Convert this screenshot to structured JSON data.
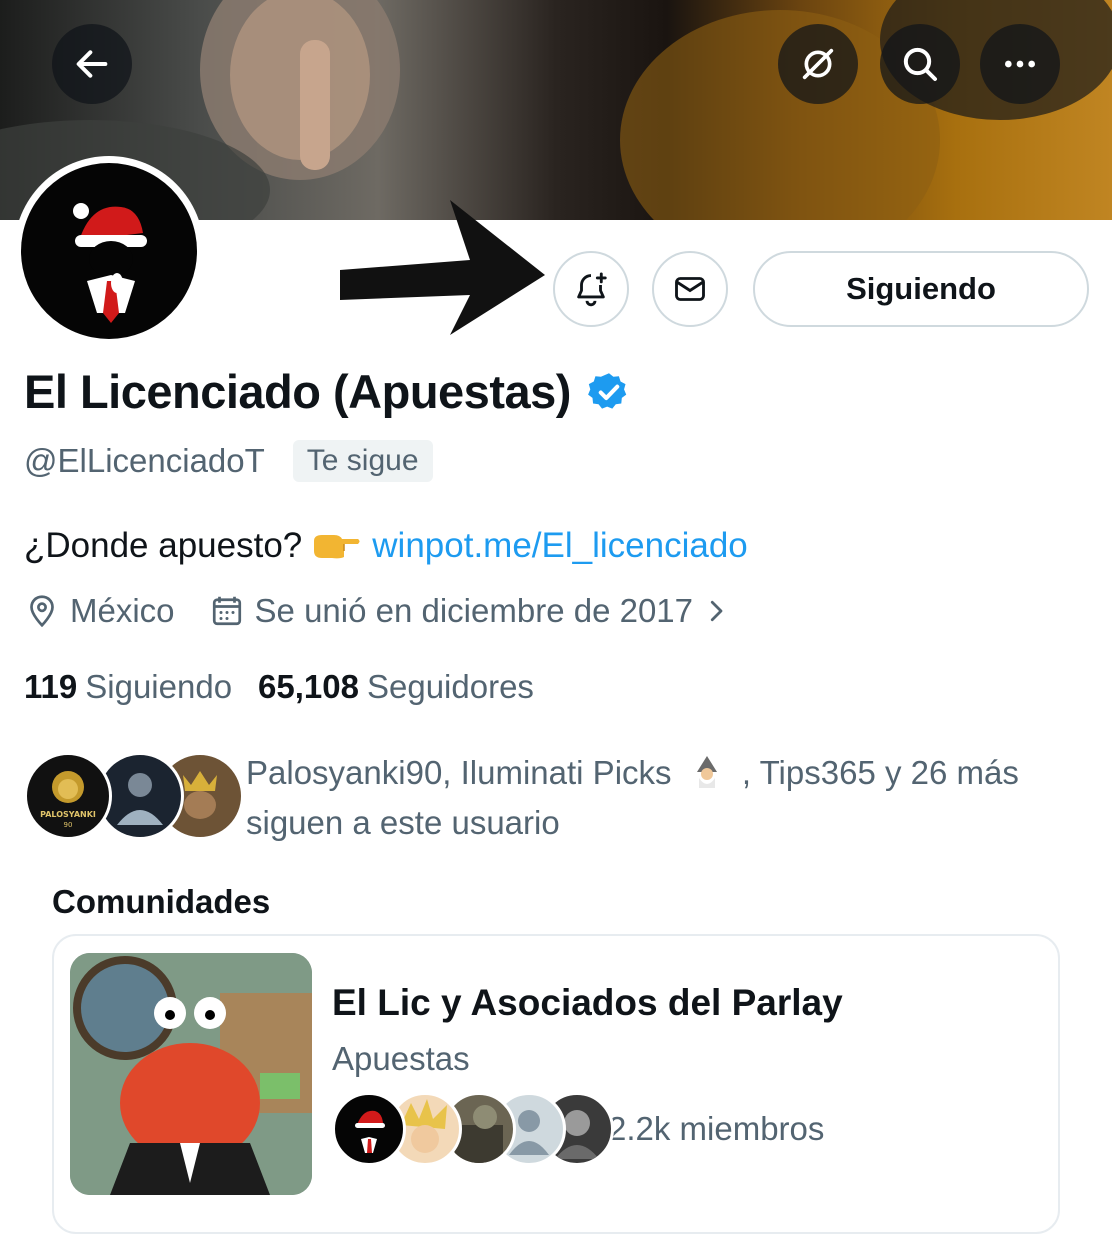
{
  "header": {
    "back_icon": "back-arrow-icon",
    "grok_icon": "grok-icon",
    "search_icon": "search-icon",
    "more_icon": "more-icon"
  },
  "profile": {
    "display_name": "El Licenciado (Apuestas)",
    "verified": true,
    "handle": "@ElLicenciadoT",
    "follows_you": "Te sigue",
    "bio_text": "¿Donde apuesto?",
    "bio_link": "winpot.me/El_licenciado",
    "location": "México",
    "joined": "Se unió en diciembre de 2017",
    "following_count": "119",
    "following_label": "Siguiendo",
    "followers_count": "65,108",
    "followers_label": "Seguidores"
  },
  "actions": {
    "follow_button_label": "Siguiendo",
    "notify_icon": "bell-plus-icon",
    "message_icon": "envelope-icon"
  },
  "followers_you_know": {
    "names": "Palosyanki90, Iluminati Picks",
    "rest": ", Tips365 y 26 más",
    "line2": "siguen a este usuario",
    "avatar1_text": "PALOSYANKI",
    "avatar1_num": "90"
  },
  "communities": {
    "section_title": "Comunidades",
    "items": [
      {
        "name": "El Lic y Asociados del Parlay",
        "category": "Apuestas",
        "members": "2.2k miembros"
      }
    ]
  },
  "colors": {
    "accent": "#1d9bf0",
    "text_primary": "#0f1419",
    "text_secondary": "#536471",
    "border": "#cfd9de"
  }
}
